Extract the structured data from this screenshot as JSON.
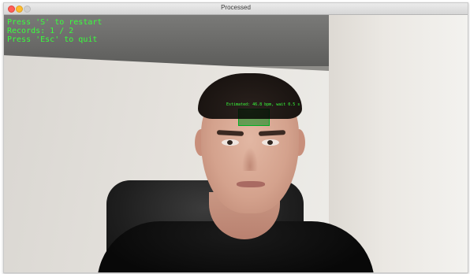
{
  "window": {
    "title": "Processed"
  },
  "overlay": {
    "lines": [
      "Press 'S' to restart",
      "Records: 1 / 2",
      "Press 'Esc' to quit"
    ]
  },
  "forehead": {
    "label": "Estimated: 46.8 bpm, wait 0.5 s"
  },
  "colors": {
    "overlay_text": "#39ff3c",
    "roi_fill": "#00c828"
  }
}
